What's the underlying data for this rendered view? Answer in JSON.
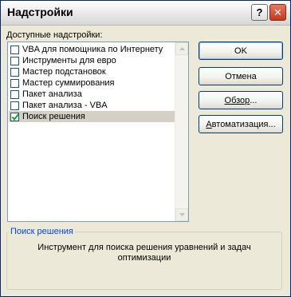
{
  "window": {
    "title": "Надстройки"
  },
  "titlebar": {
    "help_glyph": "?",
    "close_glyph": "✕"
  },
  "available": {
    "label_prefix": "Д",
    "label_rest": "оступные надстройки:"
  },
  "list": {
    "items": [
      {
        "label": "VBA для помощника по Интернету",
        "checked": false
      },
      {
        "label": "Инструменты для евро",
        "checked": false
      },
      {
        "label": "Мастер подстановок",
        "checked": false
      },
      {
        "label": "Мастер суммирования",
        "checked": false
      },
      {
        "label": "Пакет анализа",
        "checked": false
      },
      {
        "label": "Пакет анализа - VBA",
        "checked": false
      },
      {
        "label": "Поиск решения",
        "checked": true,
        "selected": true
      }
    ]
  },
  "buttons": {
    "ok": "OK",
    "cancel": "Отмена",
    "browse_prefix": "Обзор",
    "browse_suffix": "...",
    "automation_prefix": "А",
    "automation_rest": "втоматизация..."
  },
  "description": {
    "title": "Поиск решения",
    "text": "Инструмент для поиска решения уравнений и задач оптимизации"
  },
  "colors": {
    "accent_blue": "#0046d5",
    "check_green": "#21a121",
    "close_red": "#c2391c"
  },
  "icons": [
    "help-icon",
    "close-icon",
    "checkmark-icon",
    "scroll-up-icon",
    "scroll-down-icon"
  ]
}
